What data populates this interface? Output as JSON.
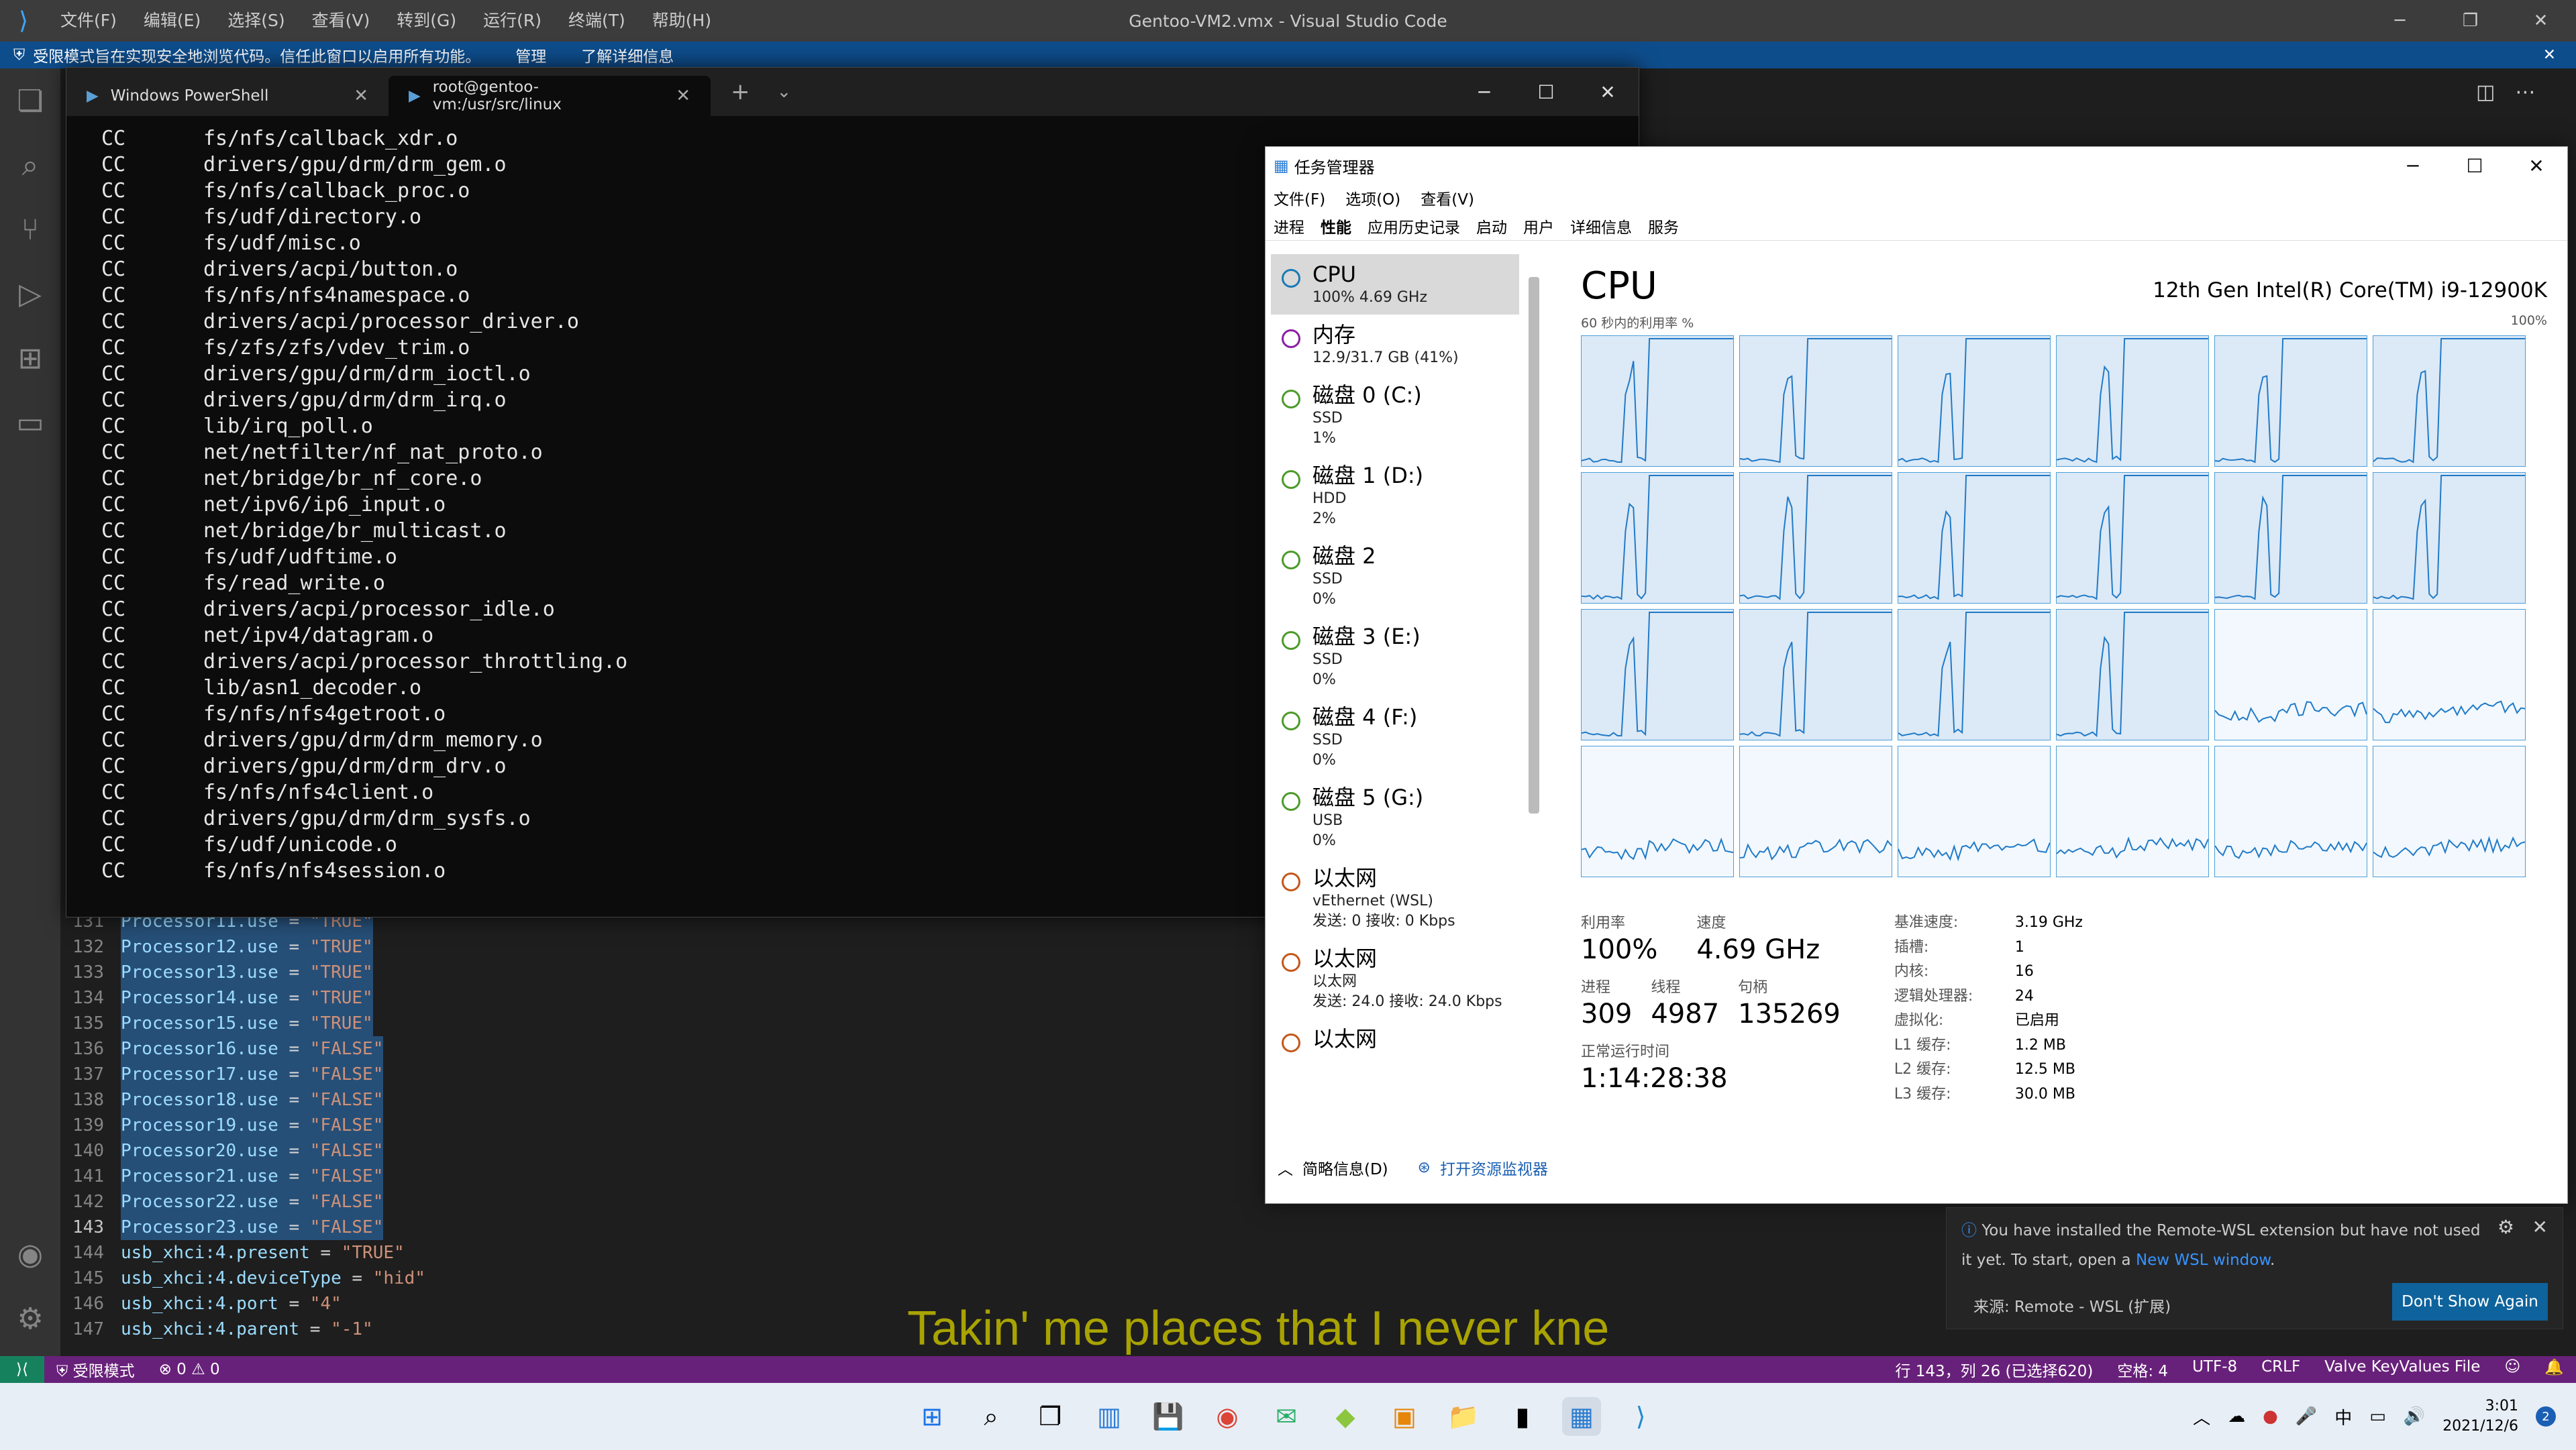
{
  "titlebar": {
    "menu": [
      "文件(F)",
      "编辑(E)",
      "选择(S)",
      "查看(V)",
      "转到(G)",
      "运行(R)",
      "终端(T)",
      "帮助(H)"
    ],
    "title": "Gentoo-VM2.vmx - Visual Studio Code"
  },
  "banner": {
    "text": "受限模式旨在实现安全地浏览代码。信任此窗口以启用所有功能。",
    "manage": "管理",
    "learn": "了解详细信息"
  },
  "editor": {
    "lines": [
      {
        "n": "131",
        "k": "Processor11.use",
        "v": "\"TRUE\"",
        "sel": true
      },
      {
        "n": "132",
        "k": "Processor12.use",
        "v": "\"TRUE\"",
        "sel": true
      },
      {
        "n": "133",
        "k": "Processor13.use",
        "v": "\"TRUE\"",
        "sel": true
      },
      {
        "n": "134",
        "k": "Processor14.use",
        "v": "\"TRUE\"",
        "sel": true
      },
      {
        "n": "135",
        "k": "Processor15.use",
        "v": "\"TRUE\"",
        "sel": true
      },
      {
        "n": "136",
        "k": "Processor16.use",
        "v": "\"FALSE\"",
        "sel": true
      },
      {
        "n": "137",
        "k": "Processor17.use",
        "v": "\"FALSE\"",
        "sel": true
      },
      {
        "n": "138",
        "k": "Processor18.use",
        "v": "\"FALSE\"",
        "sel": true
      },
      {
        "n": "139",
        "k": "Processor19.use",
        "v": "\"FALSE\"",
        "sel": true
      },
      {
        "n": "140",
        "k": "Processor20.use",
        "v": "\"FALSE\"",
        "sel": true
      },
      {
        "n": "141",
        "k": "Processor21.use",
        "v": "\"FALSE\"",
        "sel": true
      },
      {
        "n": "142",
        "k": "Processor22.use",
        "v": "\"FALSE\"",
        "sel": true
      },
      {
        "n": "143",
        "k": "Processor23.use",
        "v": "\"FALSE\"",
        "sel": true
      },
      {
        "n": "144",
        "k": "usb_xhci:4.present",
        "v": "\"TRUE\"",
        "sel": false
      },
      {
        "n": "145",
        "k": "usb_xhci:4.deviceType",
        "v": "\"hid\"",
        "sel": false
      },
      {
        "n": "146",
        "k": "usb_xhci:4.port",
        "v": "\"4\"",
        "sel": false
      },
      {
        "n": "147",
        "k": "usb_xhci:4.parent",
        "v": "\"-1\"",
        "sel": false
      }
    ]
  },
  "terminal": {
    "tabs": [
      {
        "label": "Windows PowerShell"
      },
      {
        "label": "root@gentoo-vm:/usr/src/linux"
      }
    ],
    "lines": [
      [
        "CC",
        "fs/nfs/callback_xdr.o"
      ],
      [
        "CC",
        "drivers/gpu/drm/drm_gem.o"
      ],
      [
        "CC",
        "fs/nfs/callback_proc.o"
      ],
      [
        "CC",
        "fs/udf/directory.o"
      ],
      [
        "CC",
        "fs/udf/misc.o"
      ],
      [
        "CC",
        "drivers/acpi/button.o"
      ],
      [
        "CC",
        "fs/nfs/nfs4namespace.o"
      ],
      [
        "CC",
        "drivers/acpi/processor_driver.o"
      ],
      [
        "CC",
        "fs/zfs/zfs/vdev_trim.o"
      ],
      [
        "CC",
        "drivers/gpu/drm/drm_ioctl.o"
      ],
      [
        "CC",
        "drivers/gpu/drm/drm_irq.o"
      ],
      [
        "CC",
        "lib/irq_poll.o"
      ],
      [
        "CC",
        "net/netfilter/nf_nat_proto.o"
      ],
      [
        "CC",
        "net/bridge/br_nf_core.o"
      ],
      [
        "CC",
        "net/ipv6/ip6_input.o"
      ],
      [
        "CC",
        "net/bridge/br_multicast.o"
      ],
      [
        "CC",
        "fs/udf/udftime.o"
      ],
      [
        "CC",
        "fs/read_write.o"
      ],
      [
        "CC",
        "drivers/acpi/processor_idle.o"
      ],
      [
        "CC",
        "net/ipv4/datagram.o"
      ],
      [
        "CC",
        "drivers/acpi/processor_throttling.o"
      ],
      [
        "CC",
        "lib/asn1_decoder.o"
      ],
      [
        "CC",
        "fs/nfs/nfs4getroot.o"
      ],
      [
        "CC",
        "drivers/gpu/drm/drm_memory.o"
      ],
      [
        "CC",
        "drivers/gpu/drm/drm_drv.o"
      ],
      [
        "CC",
        "fs/nfs/nfs4client.o"
      ],
      [
        "CC",
        "drivers/gpu/drm/drm_sysfs.o"
      ],
      [
        "CC",
        "fs/udf/unicode.o"
      ],
      [
        "CC",
        "fs/nfs/nfs4session.o"
      ]
    ]
  },
  "taskmgr": {
    "title": "任务管理器",
    "menu": [
      "文件(F)",
      "选项(O)",
      "查看(V)"
    ],
    "tabs": [
      "进程",
      "性能",
      "应用历史记录",
      "启动",
      "用户",
      "详细信息",
      "服务"
    ],
    "side": [
      {
        "name": "CPU",
        "sub1": "100% 4.69 GHz",
        "sub2": "",
        "color": "#1a7ab5",
        "selected": true
      },
      {
        "name": "内存",
        "sub1": "12.9/31.7 GB (41%)",
        "sub2": "",
        "color": "#8b1ea3",
        "selected": false
      },
      {
        "name": "磁盘 0 (C:)",
        "sub1": "SSD",
        "sub2": "1%",
        "color": "#4c9a2a",
        "selected": false
      },
      {
        "name": "磁盘 1 (D:)",
        "sub1": "HDD",
        "sub2": "2%",
        "color": "#4c9a2a",
        "selected": false
      },
      {
        "name": "磁盘 2",
        "sub1": "SSD",
        "sub2": "0%",
        "color": "#4c9a2a",
        "selected": false
      },
      {
        "name": "磁盘 3 (E:)",
        "sub1": "SSD",
        "sub2": "0%",
        "color": "#4c9a2a",
        "selected": false
      },
      {
        "name": "磁盘 4 (F:)",
        "sub1": "SSD",
        "sub2": "0%",
        "color": "#4c9a2a",
        "selected": false
      },
      {
        "name": "磁盘 5 (G:)",
        "sub1": "USB",
        "sub2": "0%",
        "color": "#4c9a2a",
        "selected": false
      },
      {
        "name": "以太网",
        "sub1": "vEthernet (WSL)",
        "sub2": "发送: 0 接收: 0 Kbps",
        "color": "#c4571a",
        "selected": false
      },
      {
        "name": "以太网",
        "sub1": "以太网",
        "sub2": "发送: 24.0 接收: 24.0 Kbps",
        "color": "#c4571a",
        "selected": false
      },
      {
        "name": "以太网",
        "sub1": "",
        "sub2": "",
        "color": "#c4571a",
        "selected": false
      }
    ],
    "main": {
      "title": "CPU",
      "model": "12th Gen Intel(R) Core(TM) i9-12900K",
      "cap_left": "60 秒内的利用率 %",
      "cap_right": "100%",
      "util_label": "利用率",
      "util": "100%",
      "speed_label": "速度",
      "speed": "4.69 GHz",
      "proc_label": "进程",
      "proc": "309",
      "thread_label": "线程",
      "thread": "4987",
      "handle_label": "句柄",
      "handle": "135269",
      "uptime_label": "正常运行时间",
      "uptime": "1:14:28:38",
      "kv": [
        [
          "基准速度:",
          "3.19 GHz"
        ],
        [
          "插槽:",
          "1"
        ],
        [
          "内核:",
          "16"
        ],
        [
          "逻辑处理器:",
          "24"
        ],
        [
          "虚拟化:",
          "已启用"
        ],
        [
          "L1 缓存:",
          "1.2 MB"
        ],
        [
          "L2 缓存:",
          "12.5 MB"
        ],
        [
          "L3 缓存:",
          "30.0 MB"
        ]
      ]
    },
    "footer": {
      "brief": "简略信息(D)",
      "monitor": "打开资源监视器"
    }
  },
  "toast": {
    "text": "You have installed the Remote-WSL extension but have not used it yet. To start, open a",
    "link": "New WSL window",
    "source": "来源: Remote - WSL (扩展)",
    "button": "Don't Show Again"
  },
  "lyric": "Takin' me places that I never kne",
  "status": {
    "restricted": "受限模式",
    "problems": "⊗ 0 ⚠ 0",
    "position": "行 143，列 26 (已选择620)",
    "spaces": "空格: 4",
    "encoding": "UTF-8",
    "eol": "CRLF",
    "lang": "Valve KeyValues File"
  },
  "taskbar": {
    "ime": "中",
    "time": "3:01",
    "date": "2021/12/6",
    "badge": "2"
  }
}
